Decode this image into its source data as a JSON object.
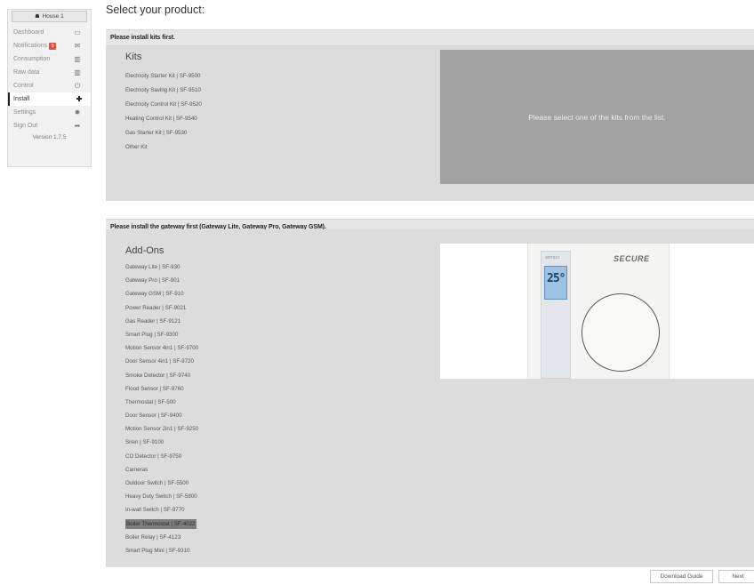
{
  "sidebar": {
    "house_label": "House 1",
    "items": [
      {
        "label": "Dashboard",
        "icon": "monitor-icon",
        "glyph": "▭"
      },
      {
        "label": "Notifications",
        "icon": "envelope-icon",
        "glyph": "✉",
        "badge": "9"
      },
      {
        "label": "Consumption",
        "icon": "bar-chart-icon",
        "glyph": "▥"
      },
      {
        "label": "Raw data",
        "icon": "bar-chart-icon",
        "glyph": "▥"
      },
      {
        "label": "Control",
        "icon": "power-icon",
        "glyph": "⏻"
      },
      {
        "label": "Install",
        "icon": "plus-icon",
        "glyph": "✚",
        "active": true
      },
      {
        "label": "Settings",
        "icon": "gear-icon",
        "glyph": "✹"
      },
      {
        "label": "Sign Out",
        "icon": "sign-out-icon",
        "glyph": "➦"
      }
    ],
    "version": "Version 1.7.5"
  },
  "main": {
    "title": "Select your product:",
    "kits_section": {
      "notice": "Please install kits first.",
      "heading": "Kits",
      "items": [
        "Electricity Starter Kit | SF-9500",
        "Electricity Saving Kit | SF-9510",
        "Electricity Control Kit | SF-9520",
        "Heating Control Kit | SF-9540",
        "Gas Starter Kit | SF-9530",
        "Other Kit"
      ],
      "placeholder": "Please select one of the kits from the list."
    },
    "addons_section": {
      "notice": "Please install the gateway first (Gateway Lite, Gateway Pro, Gateway GSM).",
      "heading": "Add-Ons",
      "items": [
        "Gateway Lite | SF-930",
        "Gateway Pro | SF-901",
        "Gateway GSM | SF-910",
        "Power Reader | SF-9021",
        "Gas Reader | SF-9121",
        "Smart Plug | SF-9300",
        "Motion Sensor 4in1 | SF-9700",
        "Door Sensor 4in1 | SF-9720",
        "Smoke Detector | SF-9740",
        "Flood Sensor | SF-9760",
        "Thermostat | SF-500",
        "Door Sensor | SF-9400",
        "Motion Sensor 2in1 | SF-9250",
        "Siren | SF-9100",
        "CO Detector | SF-9750",
        "Cameras",
        "Outdoor Switch | SF-5500",
        "Heavy Duty Switch | SF-5800",
        "In-wall Switch | SF-9770",
        "Boiler Thermostat | SF-4022",
        "Boiler Relay | SF-4123",
        "Smart Plug Mini | SF-9310"
      ],
      "selected_index": 19,
      "preview": {
        "device_label": "SRT321",
        "temperature": "25°",
        "brand": "SECURE"
      }
    },
    "buttons": {
      "download_guide": "Download Guide",
      "next": "Next"
    }
  }
}
